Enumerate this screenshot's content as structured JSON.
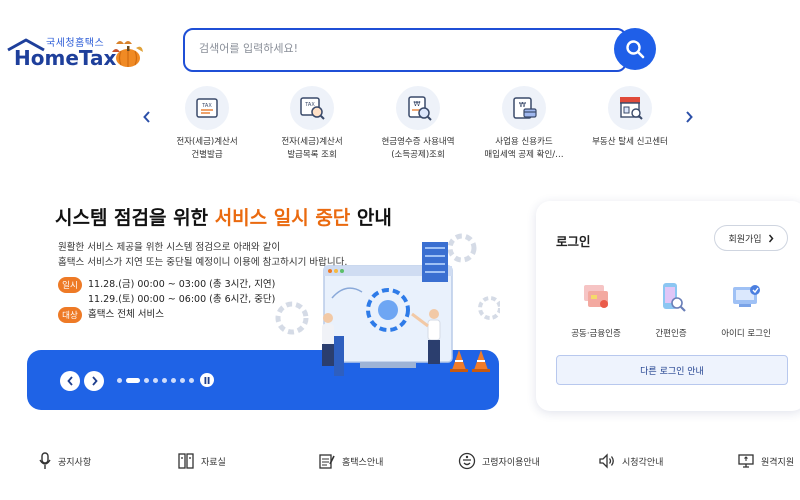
{
  "brand": {
    "small_text": "국세청홈택스",
    "name": "HomeTax"
  },
  "search": {
    "placeholder": "검색어를 입력하세요!",
    "button_icon": "search-icon"
  },
  "quick_menu": {
    "prev_icon": "chevron-left-icon",
    "next_icon": "chevron-right-icon",
    "items": [
      {
        "label_line1": "전자(세금)계산서",
        "label_line2": "건별발급",
        "icon": "tax-invoice-icon"
      },
      {
        "label_line1": "전자(세금)계산서",
        "label_line2": "발급목록 조회",
        "icon": "tax-invoice-search-icon"
      },
      {
        "label_line1": "현금영수증 사용내역",
        "label_line2": "(소득공제)조회",
        "icon": "cash-receipt-icon"
      },
      {
        "label_line1": "사업용 신용카드",
        "label_line2": "매입세액 공제 확인/…",
        "icon": "credit-card-icon"
      },
      {
        "label_line1": "부동산 탈세 신고센터",
        "label_line2": "",
        "icon": "store-icon"
      }
    ]
  },
  "banner": {
    "title_part1": "시스템 점검을 위한 ",
    "title_highlight": "서비스 일시 중단",
    "title_part2": " 안내",
    "desc_line1": "원활한 서비스 제공을 위한 시스템 점검으로 아래와 같이",
    "desc_line2": "홈택스 서비스가 지연 또는 중단될 예정이니 이용에 참고하시기 바랍니다.",
    "badge_time": "일시",
    "schedule_line1": "11.28.(금) 00:00 ~ 03:00 (총 3시간, 지연)",
    "schedule_line2": "11.29.(토) 00:00 ~ 06:00 (총 6시간, 중단)",
    "badge_target": "대상",
    "target_text": "홈택스 전체 서비스",
    "slide_count": 8,
    "active_slide": 1,
    "colors": {
      "highlight": "#ea6a0f",
      "bar": "#1f63e6",
      "badge": "#ee7a26"
    }
  },
  "login": {
    "title": "로그인",
    "join_label": "회원가입",
    "options": [
      {
        "label": "공동·금융인증",
        "icon": "certificate-icon"
      },
      {
        "label": "간편인증",
        "icon": "mobile-auth-icon"
      },
      {
        "label": "아이디 로그인",
        "icon": "id-login-icon"
      }
    ],
    "other_login_label": "다른 로그인 안내"
  },
  "bottom_nav": [
    {
      "label": "공지사항",
      "icon": "microphone-icon"
    },
    {
      "label": "자료실",
      "icon": "archive-icon"
    },
    {
      "label": "홈택스안내",
      "icon": "guide-icon"
    },
    {
      "label": "고령자이용안내",
      "icon": "senior-icon"
    },
    {
      "label": "시청각안내",
      "icon": "speaker-icon"
    },
    {
      "label": "원격지원",
      "icon": "remote-support-icon"
    }
  ]
}
